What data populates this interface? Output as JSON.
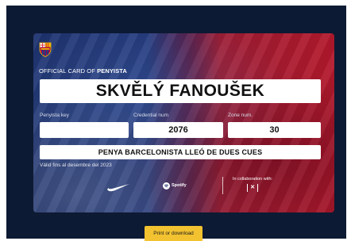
{
  "card": {
    "official_prefix": "OFFICIAL CARD OF",
    "official_strong": "PENYISTA",
    "name": "SKVĚLÝ FANOUŠEK",
    "labels": {
      "penyista_key": "Penyista key",
      "credential_num": "Credential num",
      "zone_num": "Zone num."
    },
    "values": {
      "penyista_key": "",
      "credential_num": "2076",
      "zone_num": "30"
    },
    "penya_name": "PENYA BARCELONISTA LLEÓ DE DUES CUES",
    "valid_text": "Vàlid fins al desembre del 2023",
    "sponsor_spotify": "Spotify",
    "collab_text": "In collaboration with:"
  },
  "actions": {
    "print_label": "Print or download"
  },
  "colors": {
    "card_blue": "#1b2f6b",
    "card_red": "#b3192c",
    "background": "#0d1a33",
    "button": "#f2c230"
  },
  "icons": [
    "fc-barcelona-crest-icon",
    "nike-swoosh-icon",
    "spotify-icon",
    "partner-logo-icon"
  ]
}
